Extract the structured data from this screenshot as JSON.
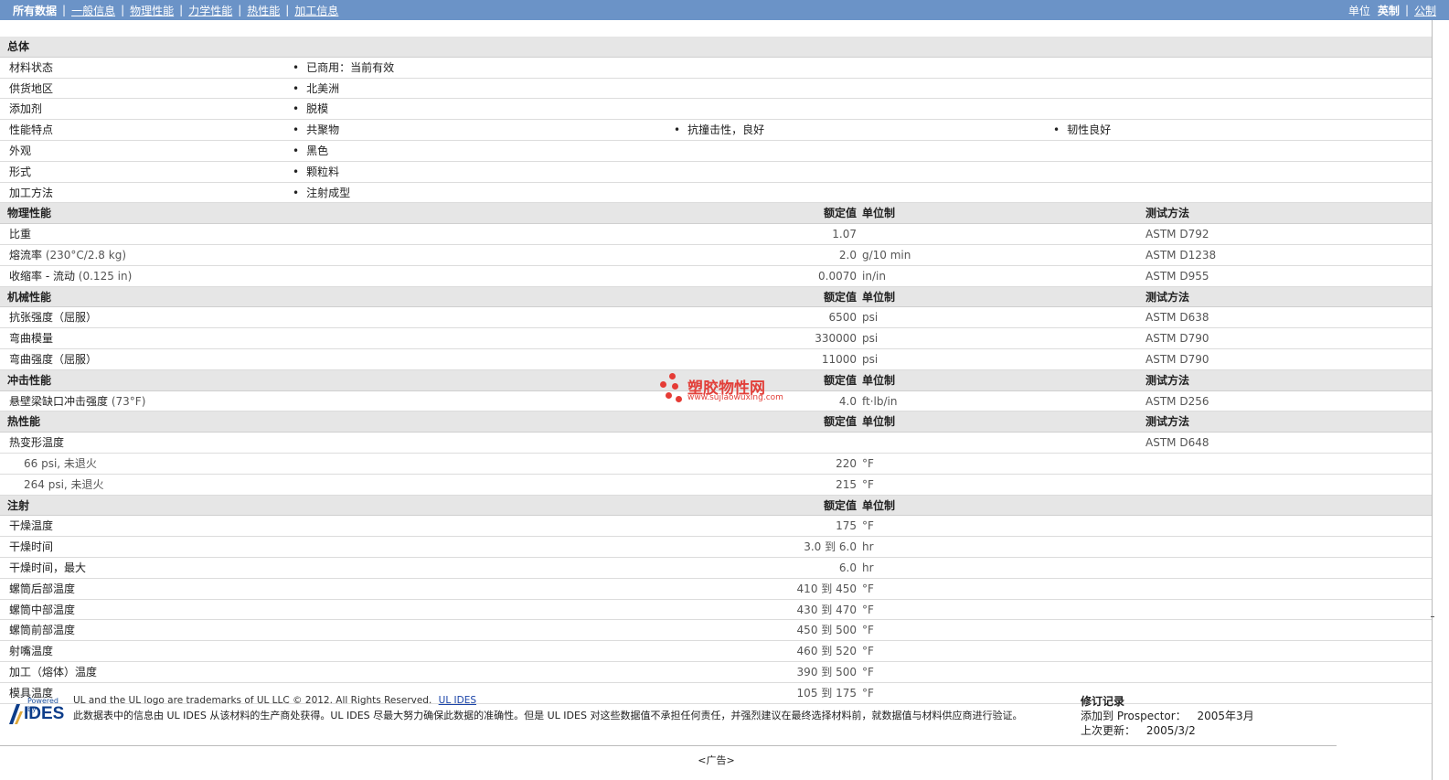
{
  "nav": {
    "current": "所有数据",
    "links": [
      "一般信息",
      "物理性能",
      "力学性能",
      "热性能",
      "加工信息"
    ]
  },
  "units": {
    "label": "单位",
    "active": "英制",
    "other": "公制"
  },
  "headers": {
    "nominal": "额定值",
    "unit": "单位制",
    "method": "测试方法"
  },
  "general": {
    "title": "总体",
    "material_status": {
      "label": "材料状态",
      "values": [
        "已商用：当前有效"
      ]
    },
    "availability": {
      "label": "供货地区",
      "values": [
        "北美洲"
      ]
    },
    "additive": {
      "label": "添加剂",
      "values": [
        "脱模"
      ]
    },
    "features": {
      "label": "性能特点",
      "values": [
        "共聚物",
        "抗撞击性，良好",
        "韧性良好"
      ]
    },
    "appearance": {
      "label": "外观",
      "values": [
        "黑色"
      ]
    },
    "form": {
      "label": "形式",
      "values": [
        "颗粒料"
      ]
    },
    "processing": {
      "label": "加工方法",
      "values": [
        "注射成型"
      ]
    }
  },
  "physical": {
    "title": "物理性能",
    "rows": [
      {
        "name": "比重",
        "value": "1.07",
        "unit": "",
        "method": "ASTM D792"
      },
      {
        "name": "熔流率",
        "cond": "(230°C/2.8 kg)",
        "value": "2.0",
        "unit": "g/10 min",
        "method": "ASTM D1238"
      },
      {
        "name": "收缩率 - 流动",
        "cond": "(0.125 in)",
        "value": "0.0070",
        "unit": "in/in",
        "method": "ASTM D955"
      }
    ]
  },
  "mechanical": {
    "title": "机械性能",
    "rows": [
      {
        "name": "抗张强度（屈服）",
        "value": "6500",
        "unit": "psi",
        "method": "ASTM D638"
      },
      {
        "name": "弯曲模量",
        "value": "330000",
        "unit": "psi",
        "method": "ASTM D790"
      },
      {
        "name": "弯曲强度（屈服）",
        "value": "11000",
        "unit": "psi",
        "method": "ASTM D790"
      }
    ]
  },
  "impact": {
    "title": "冲击性能",
    "rows": [
      {
        "name": "悬壁梁缺口冲击强度",
        "cond": "(73°F)",
        "value": "4.0",
        "unit": "ft·lb/in",
        "method": "ASTM D256"
      }
    ]
  },
  "thermal": {
    "title": "热性能",
    "parent": {
      "name": "热变形温度",
      "method": "ASTM D648"
    },
    "rows": [
      {
        "name": "66 psi, 未退火",
        "value": "220",
        "unit": "°F"
      },
      {
        "name": "264 psi, 未退火",
        "value": "215",
        "unit": "°F"
      }
    ]
  },
  "injection": {
    "title": "注射",
    "rows": [
      {
        "name": "干燥温度",
        "value": "175",
        "unit": "°F"
      },
      {
        "name": "干燥时间",
        "value": "3.0 到  6.0",
        "unit": "hr"
      },
      {
        "name": "干燥时间，最大",
        "value": "6.0",
        "unit": "hr"
      },
      {
        "name": "螺筒后部温度",
        "value": "410 到  450",
        "unit": "°F"
      },
      {
        "name": "螺筒中部温度",
        "value": "430 到  470",
        "unit": "°F"
      },
      {
        "name": "螺筒前部温度",
        "value": "450 到  500",
        "unit": "°F"
      },
      {
        "name": "射嘴温度",
        "value": "460 到  520",
        "unit": "°F"
      },
      {
        "name": "加工（熔体）温度",
        "value": "390 到  500",
        "unit": "°F"
      },
      {
        "name": "模具温度",
        "value": "105 到  175",
        "unit": "°F"
      }
    ]
  },
  "watermark": {
    "title": "塑胶物性网",
    "url": "www.sujiaowuxing.com"
  },
  "footer": {
    "logo_powered": "Powered by",
    "logo_text": "IDES",
    "legal_line1": "UL and the UL logo are trademarks of UL LLC © 2012. All Rights Reserved.",
    "legal_link": "UL IDES",
    "legal_line2": "此数据表中的信息由  UL IDES 从该材料的生产商处获得。UL IDES 尽最大努力确保此数据的准确性。但是  UL IDES 对这些数据值不承担任何责任，并强烈建议在最终选择材料前，就数据值与材料供应商进行验证。",
    "revision_title": "修订记录",
    "added_label": "添加到  Prospector：",
    "added_value": "2005年3月",
    "updated_label": "上次更新：",
    "updated_value": "2005/3/2",
    "ad": "<广告>"
  },
  "colors": {
    "topbar": "#6b93c7",
    "section": "#e6e6e6",
    "watermark": "#e2403a"
  }
}
